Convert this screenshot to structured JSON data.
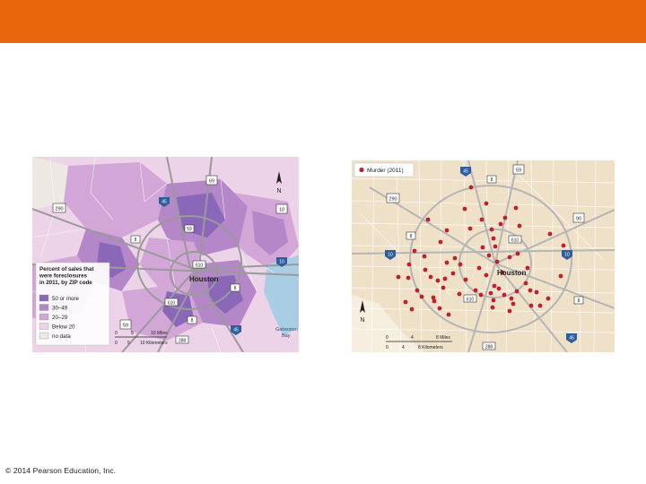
{
  "slide": {
    "top_bar_color": "#e8660a",
    "footer_text": "© 2014 Pearson Education, Inc."
  },
  "foreclosure_map": {
    "legend_title_lines": [
      "Percent of sales that",
      "were foreclosures",
      "in 2011, by ZIP code"
    ],
    "legend_entries": [
      {
        "label": "50 or more",
        "color": "#8a67b8"
      },
      {
        "label": "30–49",
        "color": "#b487c8"
      },
      {
        "label": "20–29",
        "color": "#d2a6d6"
      },
      {
        "label": "Below 20",
        "color": "#ecd3e8"
      },
      {
        "label": "no data",
        "color": "#ede9e2"
      }
    ],
    "city_label": "Houston",
    "water_label_lines": [
      "Galveston",
      "Bay"
    ],
    "highway_labels": [
      "69",
      "290",
      "45",
      "10",
      "59",
      "8",
      "610",
      "8",
      "10",
      "610",
      "8",
      "59",
      "45",
      "288"
    ],
    "north_label": "N",
    "scale_miles": [
      "0",
      "5",
      "10 Miles"
    ],
    "scale_km": [
      "0",
      "5",
      "10 Kilometers"
    ]
  },
  "murder_map": {
    "legend_label": "Murder (2011)",
    "dot_color": "#c21f2e",
    "city_label": "Houston",
    "highway_labels": [
      "45",
      "59",
      "8",
      "290",
      "90",
      "8",
      "610",
      "10",
      "10",
      "610",
      "8",
      "288",
      "45"
    ],
    "north_label": "N",
    "scale_miles": [
      "0",
      "4",
      "8 Miles"
    ],
    "scale_km": [
      "0",
      "4",
      "8 Kilometers"
    ]
  }
}
